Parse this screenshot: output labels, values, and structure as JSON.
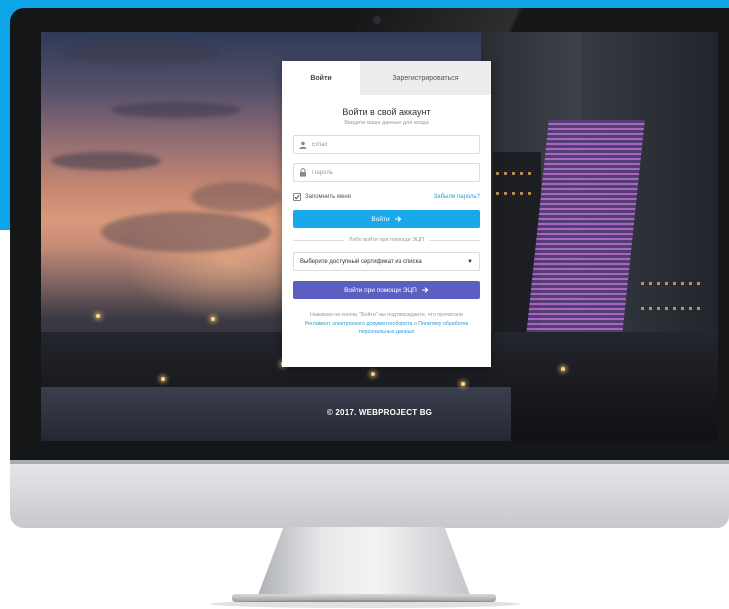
{
  "colors": {
    "background_accent": "#0ea5e8",
    "login_button": "#19a8e9",
    "eds_button": "#5b5fc2",
    "link": "#2a9bd8"
  },
  "tabs": [
    {
      "label": "Войти",
      "active": true
    },
    {
      "label": "Зарегистрироваться",
      "active": false
    }
  ],
  "form": {
    "title": "Войти в свой аккаунт",
    "subtitle": "Введите ваши данные для входа",
    "email": {
      "icon": "user-icon",
      "placeholder": "Email",
      "value": ""
    },
    "password": {
      "icon": "lock-icon",
      "placeholder": "Пароль",
      "value": ""
    },
    "remember": {
      "label": "Запомнить меня",
      "checked": true
    },
    "forgot_label": "Забыли пароль?",
    "login_button": {
      "label": "Войти",
      "icon": "arrow-right-icon"
    },
    "divider_label": "Либо войти при помощи ЭЦП",
    "certificate_select": {
      "selected": "Выберите доступный сертификат из списка"
    },
    "eds_button": {
      "label": "Войти при помощи ЭЦП",
      "icon": "arrow-right-icon"
    },
    "legal": {
      "prefix": "Нажимая на кнопку \"Войти\" вы подтверждаете, что прочитали",
      "link1": "Регламент электронного документооборота",
      "connector": " и ",
      "link2": "Политику обработки персональных данных"
    }
  },
  "footer": {
    "copyright": "© 2017. WEBPROJECT BG"
  }
}
